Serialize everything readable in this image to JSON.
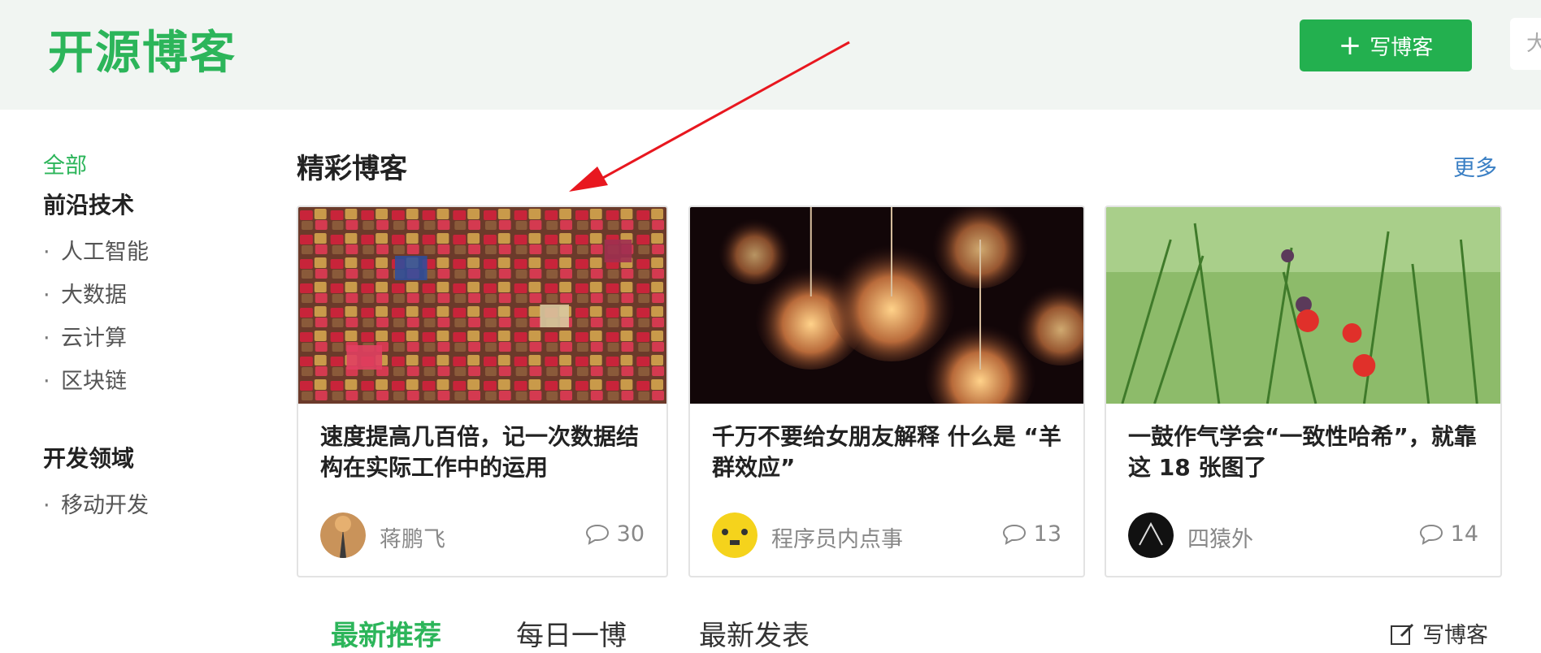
{
  "header": {
    "logo": "开源博客",
    "write_button": "写博客",
    "search_placeholder_visible": "大"
  },
  "sidebar": {
    "all": "全部",
    "categories": [
      {
        "title": "前沿技术",
        "items": [
          "人工智能",
          "大数据",
          "云计算",
          "区块链"
        ]
      },
      {
        "title": "开发领域",
        "items": [
          "移动开发"
        ]
      }
    ]
  },
  "featured": {
    "title": "精彩博客",
    "more": "更多",
    "cards": [
      {
        "title": "速度提高几百倍，记一次数据结构在实际工作中的运用",
        "author": "蒋鹏飞",
        "comments": "30"
      },
      {
        "title": "千万不要给女朋友解释 什么是 “羊群效应”",
        "author": "程序员内点事",
        "comments": "13"
      },
      {
        "title": "一鼓作气学会“一致性哈希”，就靠这 18 张图了",
        "author": "四猿外",
        "comments": "14"
      }
    ]
  },
  "tabs": [
    "最新推荐",
    "每日一博",
    "最新发表"
  ],
  "write_link": "写博客",
  "colors": {
    "brand_green": "#2cb55a",
    "link_blue": "#3a7fc4",
    "arrow_red": "#e8171f"
  }
}
